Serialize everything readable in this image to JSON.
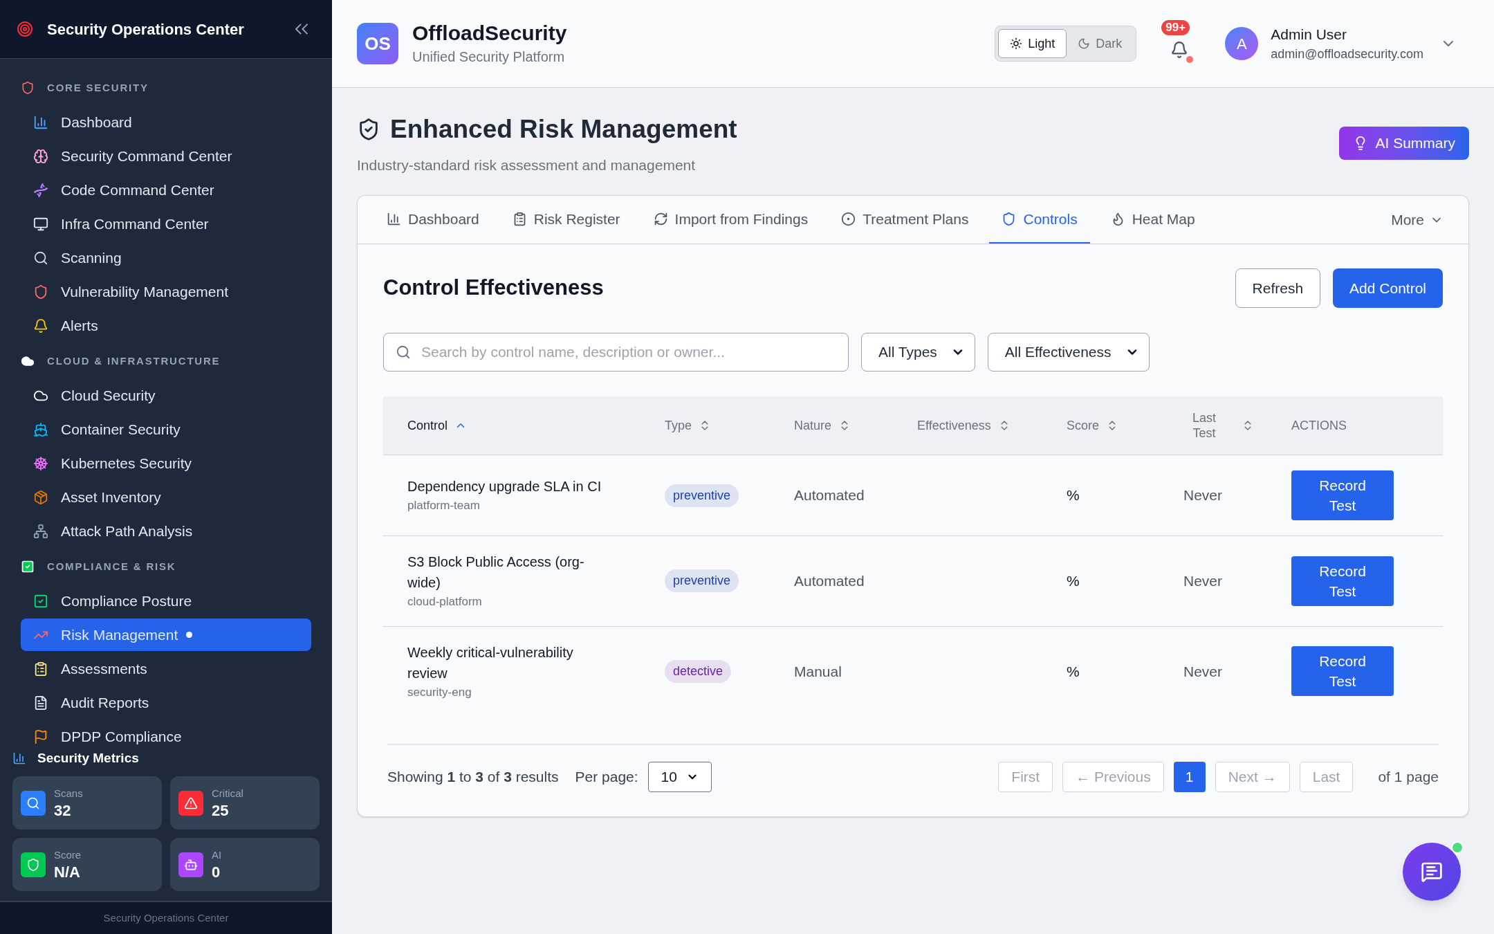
{
  "sidebar": {
    "title": "Security Operations Center",
    "sections": [
      {
        "label": "CORE SECURITY",
        "items": [
          {
            "label": "Dashboard",
            "selected": false
          },
          {
            "label": "Security Command Center",
            "selected": false
          },
          {
            "label": "Code Command Center",
            "selected": false
          },
          {
            "label": "Infra Command Center",
            "selected": false
          },
          {
            "label": "Scanning",
            "selected": false
          },
          {
            "label": "Vulnerability Management",
            "selected": false
          },
          {
            "label": "Alerts",
            "selected": false
          }
        ]
      },
      {
        "label": "CLOUD & INFRASTRUCTURE",
        "items": [
          {
            "label": "Cloud Security",
            "selected": false
          },
          {
            "label": "Container Security",
            "selected": false
          },
          {
            "label": "Kubernetes Security",
            "selected": false
          },
          {
            "label": "Asset Inventory",
            "selected": false
          },
          {
            "label": "Attack Path Analysis",
            "selected": false
          }
        ]
      },
      {
        "label": "COMPLIANCE & RISK",
        "items": [
          {
            "label": "Compliance Posture",
            "selected": false
          },
          {
            "label": "Risk Management",
            "selected": true
          },
          {
            "label": "Assessments",
            "selected": false
          },
          {
            "label": "Audit Reports",
            "selected": false
          },
          {
            "label": "DPDP Compliance",
            "selected": false
          }
        ]
      }
    ],
    "metrics_title": "Security Metrics",
    "metrics": [
      {
        "label": "Scans",
        "value": "32"
      },
      {
        "label": "Critical",
        "value": "25"
      },
      {
        "label": "Score",
        "value": "N/A"
      },
      {
        "label": "AI",
        "value": "0"
      }
    ],
    "footer": "Security Operations Center"
  },
  "header": {
    "logo": "OS",
    "brand": "OffloadSecurity",
    "tagline": "Unified Security Platform",
    "theme": [
      {
        "label": "Light",
        "selected": true
      },
      {
        "label": "Dark",
        "selected": false
      }
    ],
    "notification_badge": "99+",
    "user": {
      "avatar": "A",
      "name": "Admin User",
      "email": "admin@offloadsecurity.com"
    }
  },
  "page": {
    "title": "Enhanced Risk Management",
    "subtitle": "Industry-standard risk assessment and management",
    "ai_button": "AI Summary"
  },
  "tabs": [
    {
      "label": "Dashboard",
      "selected": false
    },
    {
      "label": "Risk Register",
      "selected": false
    },
    {
      "label": "Import from Findings",
      "selected": false
    },
    {
      "label": "Treatment Plans",
      "selected": false
    },
    {
      "label": "Controls",
      "selected": true
    },
    {
      "label": "Heat Map",
      "selected": false
    }
  ],
  "more_tab": "More",
  "panel": {
    "title": "Control Effectiveness",
    "refresh_button": "Refresh",
    "add_button": "Add Control",
    "search": {
      "placeholder": "Search by control name, description or owner..."
    },
    "filters": [
      "All Types",
      "All Effectiveness"
    ],
    "table": {
      "columns": [
        {
          "label": "Control",
          "sortable": true,
          "sorted": true
        },
        {
          "label": "Type",
          "sortable": true,
          "sorted": false
        },
        {
          "label": "Nature",
          "sortable": true,
          "sorted": false
        },
        {
          "label": "Effectiveness",
          "sortable": true,
          "sorted": false
        },
        {
          "label": "Score",
          "sortable": true,
          "sorted": false
        },
        {
          "label": "Last Test",
          "sortable": true,
          "sorted": false
        },
        {
          "label": "ACTIONS"
        }
      ],
      "rows": [
        {
          "name": "Dependency upgrade SLA in CI",
          "owner": "platform-team",
          "type": "preventive",
          "color": "#1e40af",
          "nature": "Automated",
          "score": "%",
          "last_test": "Never",
          "action": "Record Test"
        },
        {
          "name": "S3 Block Public Access (org-wide)",
          "owner": "cloud-platform",
          "type": "preventive",
          "color": "#1e40af",
          "nature": "Automated",
          "score": "%",
          "last_test": "Never",
          "action": "Record Test"
        },
        {
          "name": "Weekly critical-vulnerability review",
          "owner": "security-eng",
          "type": "detective",
          "color": "#6b21a8",
          "nature": "Manual",
          "score": "%",
          "last_test": "Never",
          "action": "Record Test"
        }
      ]
    },
    "pagination": {
      "summary": "Showing **1** to **3** of **3** results",
      "per_page_label": "Per page:",
      "per_page": "10",
      "buttons": [
        {
          "label": "First",
          "kind": "nav",
          "disabled": true
        },
        {
          "label": "← Previous",
          "kind": "nav",
          "disabled": true
        },
        {
          "label": "1",
          "kind": "page",
          "selected": true
        },
        {
          "label": "Next →",
          "kind": "nav",
          "disabled": true
        },
        {
          "label": "Last",
          "kind": "nav",
          "disabled": true
        }
      ],
      "page_count": "of 1 page"
    }
  }
}
